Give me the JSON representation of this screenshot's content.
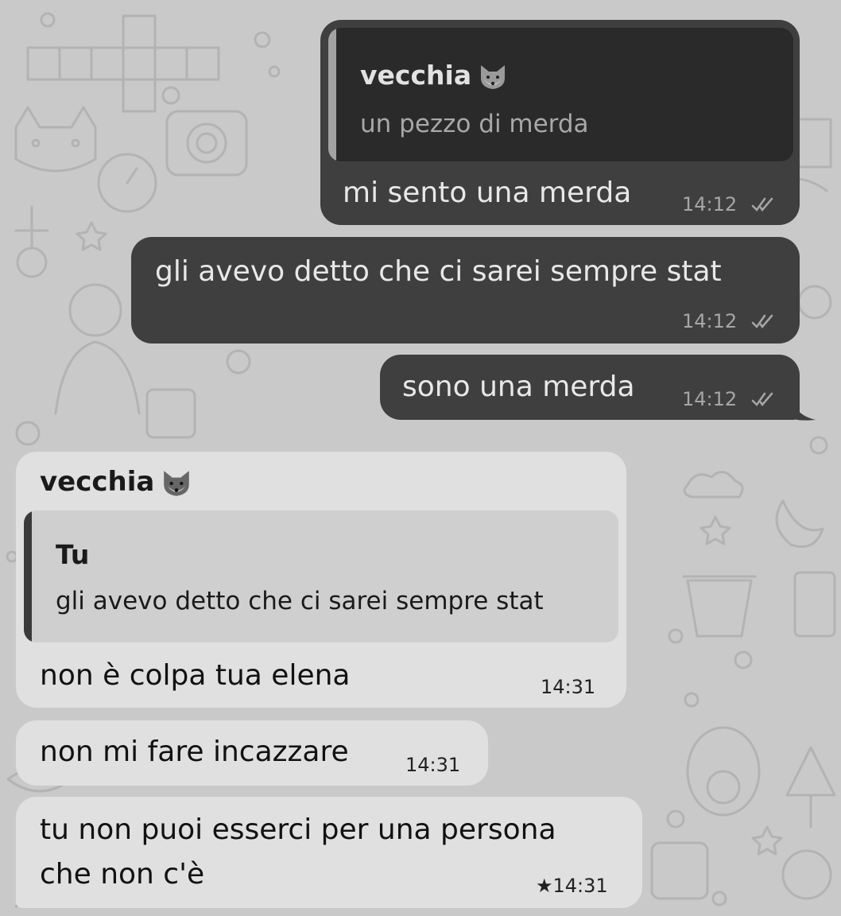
{
  "contact": {
    "name": "vecchia",
    "emoji": "fox-face-emoji"
  },
  "messages": [
    {
      "direction": "outgoing",
      "quote": {
        "name": "vecchia",
        "text": "un pezzo di merda"
      },
      "text": "mi sento una merda",
      "time": "14:12",
      "status": "read"
    },
    {
      "direction": "outgoing",
      "text": "gli avevo detto che ci sarei sempre stat",
      "time": "14:12",
      "status": "read"
    },
    {
      "direction": "outgoing",
      "text": "sono una merda",
      "time": "14:12",
      "status": "read"
    },
    {
      "direction": "incoming",
      "sender": "vecchia",
      "quote": {
        "name": "Tu",
        "text": "gli avevo detto che ci sarei sempre stat"
      },
      "text": "non è colpa tua elena",
      "time": "14:31"
    },
    {
      "direction": "incoming",
      "text": "non mi fare incazzare",
      "time": "14:31"
    },
    {
      "direction": "incoming",
      "text_lines": [
        "tu non puoi esserci per una persona",
        "che non c'è"
      ],
      "time": "★14:31",
      "starred": true
    }
  ],
  "colors": {
    "wallpaper": "#c9c9c9",
    "outgoing_bubble": "#3f3f3f",
    "incoming_bubble": "#e0e0e0"
  }
}
